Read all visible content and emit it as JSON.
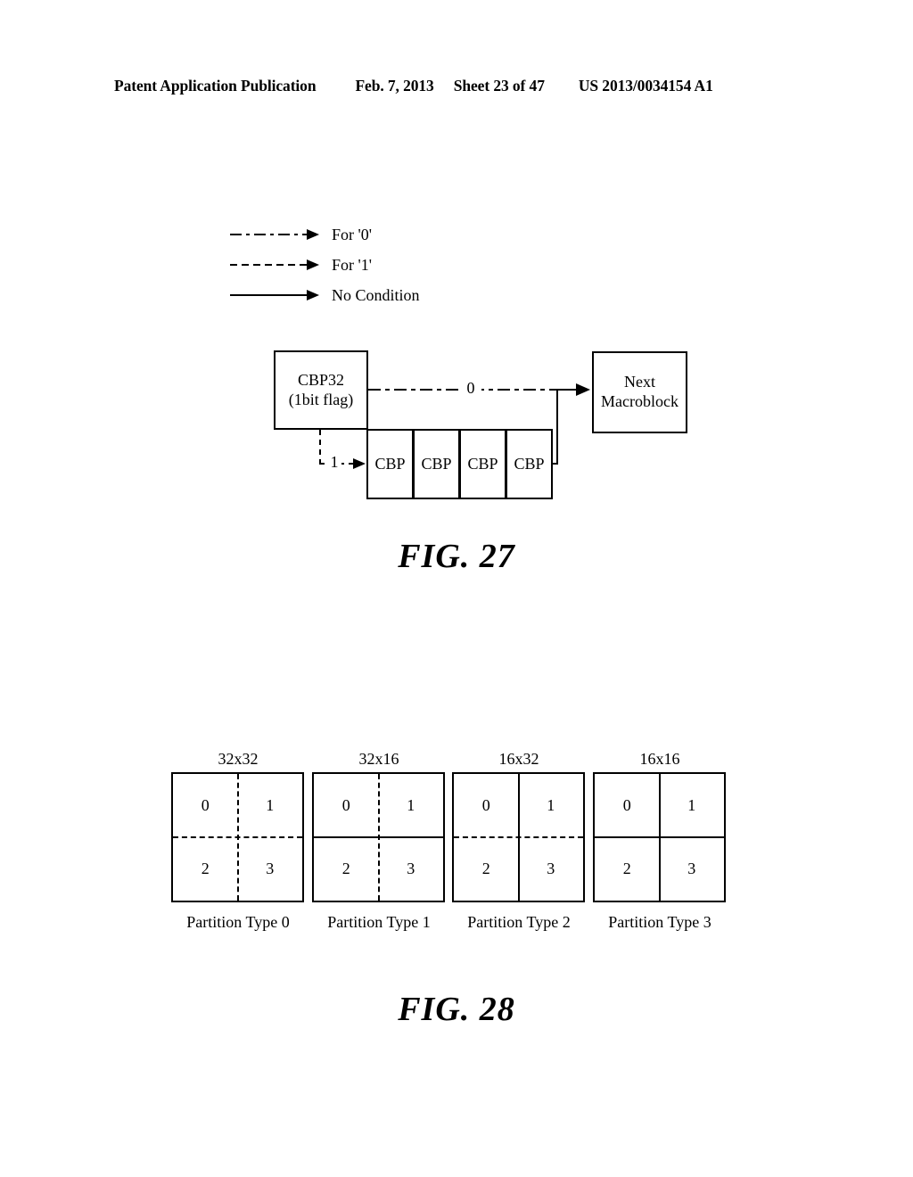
{
  "header": {
    "publication": "Patent Application Publication",
    "date": "Feb. 7, 2013",
    "sheet": "Sheet 23 of 47",
    "patent_number": "US 2013/0034154 A1"
  },
  "legend": {
    "items": [
      {
        "style": "dash-dot",
        "label": "For '0'"
      },
      {
        "style": "dashed",
        "label": "For '1'"
      },
      {
        "style": "solid",
        "label": "No Condition"
      }
    ]
  },
  "fig27": {
    "caption": "FIG. 27",
    "cbp32_box": {
      "line1": "CBP32",
      "line2": "(1bit flag)"
    },
    "next_macroblock_box": {
      "line1": "Next",
      "line2": "Macroblock"
    },
    "zero_edge_label": "0",
    "one_edge_label": "1",
    "cbp_cells": [
      "CBP",
      "CBP",
      "CBP",
      "CBP"
    ]
  },
  "fig28": {
    "caption": "FIG. 28",
    "partitions": [
      {
        "dimension": "32x32",
        "label": "Partition Type 0",
        "vertical_divider": "dashed",
        "horizontal_divider": "dashed",
        "quadrants": [
          "0",
          "1",
          "2",
          "3"
        ]
      },
      {
        "dimension": "32x16",
        "label": "Partition Type 1",
        "vertical_divider": "dashed",
        "horizontal_divider": "solid",
        "quadrants": [
          "0",
          "1",
          "2",
          "3"
        ]
      },
      {
        "dimension": "16x32",
        "label": "Partition Type 2",
        "vertical_divider": "solid",
        "horizontal_divider": "dashed",
        "quadrants": [
          "0",
          "1",
          "2",
          "3"
        ]
      },
      {
        "dimension": "16x16",
        "label": "Partition Type 3",
        "vertical_divider": "solid",
        "horizontal_divider": "solid",
        "quadrants": [
          "0",
          "1",
          "2",
          "3"
        ]
      }
    ]
  },
  "colors": {
    "ink": "#000000",
    "paper": "#ffffff"
  }
}
